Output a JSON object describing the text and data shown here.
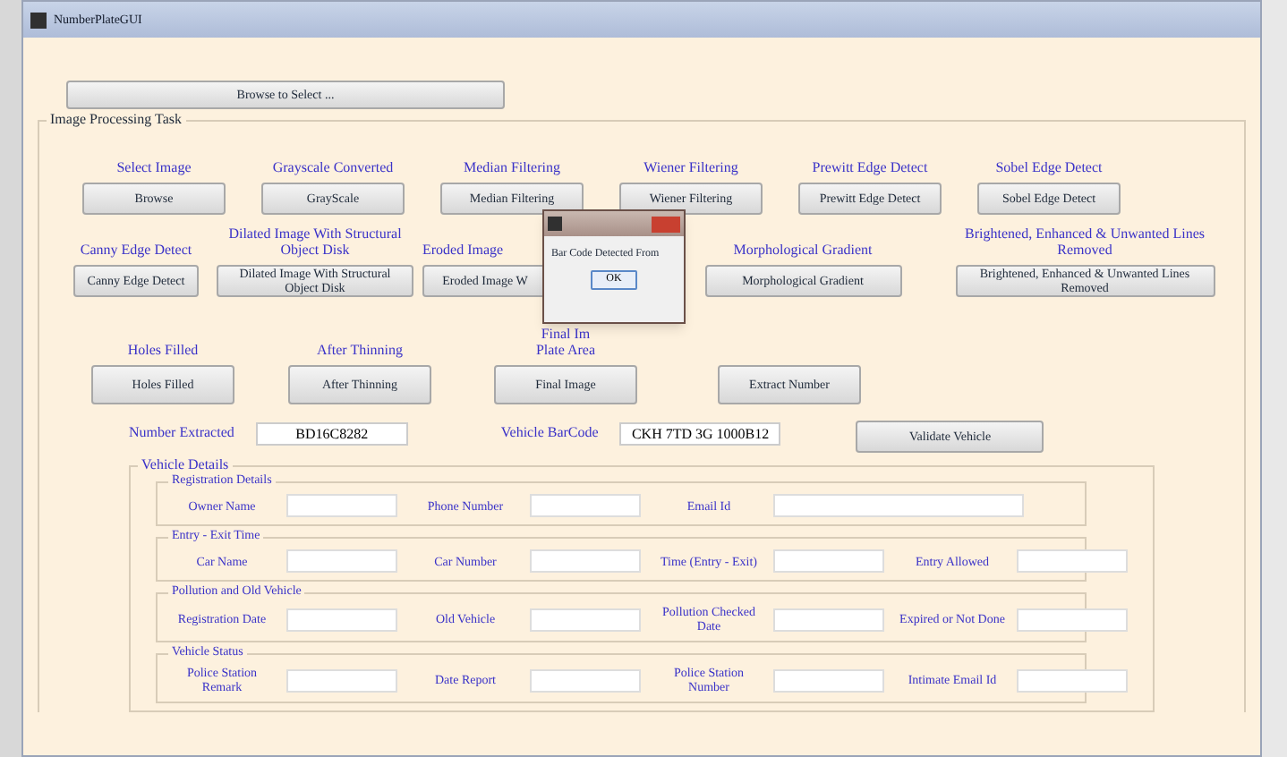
{
  "window": {
    "title": "NumberPlateGUI"
  },
  "browse_button": "Browse to Select ...",
  "panel": {
    "title": "Image Processing Task",
    "rows": [
      {
        "steps": [
          {
            "label": "Select Image",
            "button": "Browse"
          },
          {
            "label": "Grayscale Converted",
            "button": "GrayScale"
          },
          {
            "label": "Median Filtering",
            "button": "Median Filtering"
          },
          {
            "label": "Wiener Filtering",
            "button": "Wiener Filtering"
          },
          {
            "label": "Prewitt Edge Detect",
            "button": "Prewitt Edge Detect"
          },
          {
            "label": "Sobel Edge Detect",
            "button": "Sobel Edge Detect"
          }
        ]
      },
      {
        "steps": [
          {
            "label": "Canny Edge Detect",
            "button": "Canny Edge Detect"
          },
          {
            "label": "Dilated Image With Structural Object Disk",
            "button": "Dilated Image With Structural Object Disk"
          },
          {
            "label": "Eroded Image",
            "button": "Eroded Image W"
          },
          {
            "label": "Morphological Gradient",
            "button": "Morphological Gradient"
          },
          {
            "label": "Brightened, Enhanced & Unwanted Lines Removed",
            "button": "Brightened, Enhanced & Unwanted Lines Removed"
          }
        ]
      },
      {
        "steps": [
          {
            "label": "Holes Filled",
            "button": "Holes Filled"
          },
          {
            "label": "After Thinning",
            "button": "After Thinning"
          },
          {
            "label": "Final Im",
            "sublabel": "Plate Area",
            "button": "Final Image"
          },
          {
            "button": "Extract Number"
          }
        ]
      }
    ],
    "number_label": "Number Extracted",
    "number_value": "BD16C8282",
    "barcode_label": "Vehicle BarCode",
    "barcode_value": "CKH 7TD 3G 1000B12",
    "validate_button": "Validate Vehicle"
  },
  "details": {
    "title": "Vehicle Details",
    "groups": [
      {
        "title": "Registration Details",
        "fields": [
          {
            "label": "Owner Name"
          },
          {
            "label": "Phone Number"
          },
          {
            "label": "Email Id",
            "wide": true
          }
        ]
      },
      {
        "title": "Entry - Exit Time",
        "fields": [
          {
            "label": "Car Name"
          },
          {
            "label": "Car Number"
          },
          {
            "label": "Time (Entry - Exit)"
          },
          {
            "label": "Entry Allowed"
          }
        ]
      },
      {
        "title": "Pollution and Old Vehicle",
        "fields": [
          {
            "label": "Registration Date"
          },
          {
            "label": "Old Vehicle"
          },
          {
            "label": "Pollution Checked Date"
          },
          {
            "label": "Expired or Not Done"
          }
        ]
      },
      {
        "title": "Vehicle Status",
        "fields": [
          {
            "label": "Police Station Remark"
          },
          {
            "label": "Date Report"
          },
          {
            "label": "Police Station Number"
          },
          {
            "label": "Intimate Email Id"
          }
        ]
      }
    ]
  },
  "dialog": {
    "message": "Bar Code Detected From",
    "ok": "OK"
  }
}
